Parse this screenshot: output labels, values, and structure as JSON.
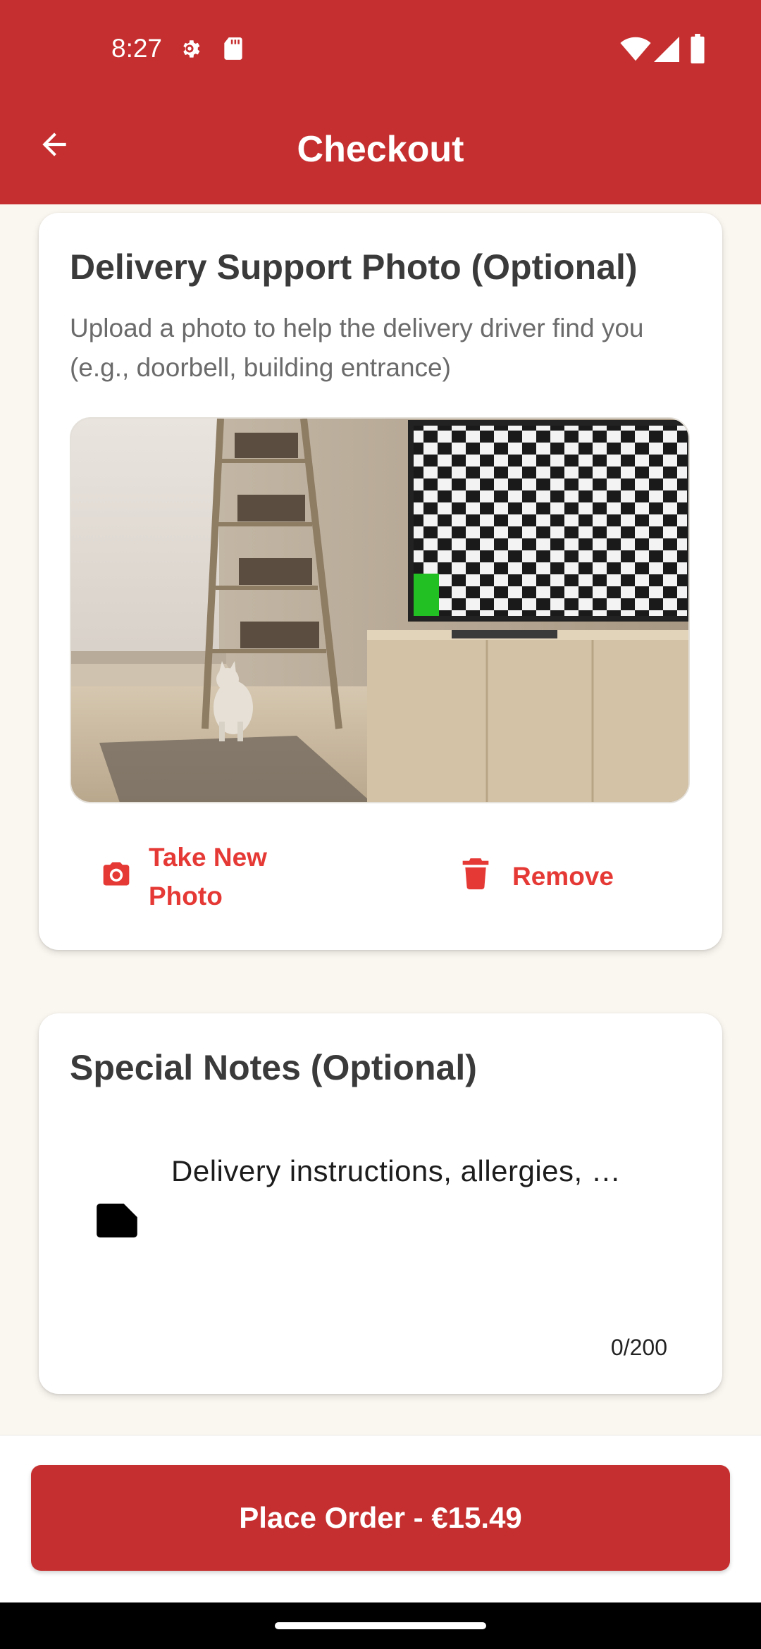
{
  "status_bar": {
    "time": "8:27",
    "icons": [
      "settings-icon",
      "sd-card-icon",
      "wifi-icon",
      "signal-icon",
      "battery-icon"
    ]
  },
  "app_bar": {
    "title": "Checkout",
    "back_icon": "arrow-back-icon"
  },
  "photo_card": {
    "title": "Delivery Support Photo (Optional)",
    "description": "Upload a photo to help the delivery driver find you (e.g., doorbell, building entrance)",
    "take_photo_label": "Take New Photo",
    "take_photo_icon": "camera-icon",
    "remove_label": "Remove",
    "remove_icon": "trash-icon"
  },
  "notes_card": {
    "title": "Special Notes (Optional)",
    "placeholder": "Delivery instructions, allergies, …",
    "counter": "0/200",
    "icon": "note-icon"
  },
  "bottom": {
    "place_order_label": "Place Order - €15.49"
  },
  "colors": {
    "primary": "#c62f2f",
    "accent": "#e53935",
    "background": "#faf6f0"
  }
}
